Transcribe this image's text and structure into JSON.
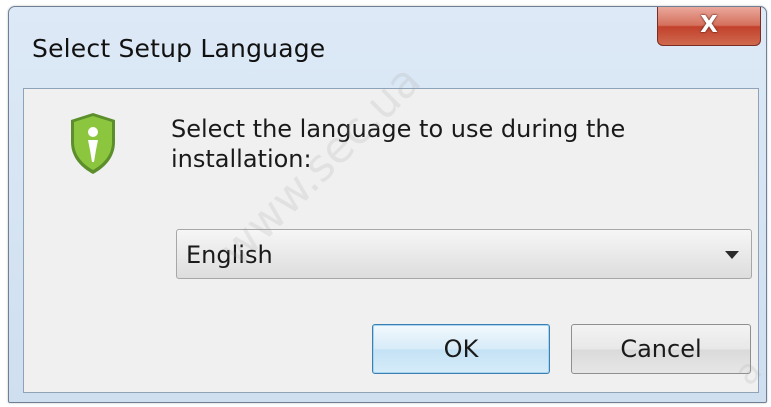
{
  "window": {
    "title": "Select Setup Language",
    "close_glyph": "X"
  },
  "dialog": {
    "icon": "setup-shield-icon",
    "prompt": "Select the language to use during the installation:",
    "language_select": {
      "value": "English"
    },
    "ok_label": "OK",
    "cancel_label": "Cancel"
  },
  "watermark": {
    "text": "www.sec.ua",
    "text_corner": "a"
  },
  "colors": {
    "shield_green": "#8cc63f",
    "close_red": "#c9553f",
    "client_bg": "#f0f0f0",
    "default_button_border": "#3c7fb1"
  }
}
